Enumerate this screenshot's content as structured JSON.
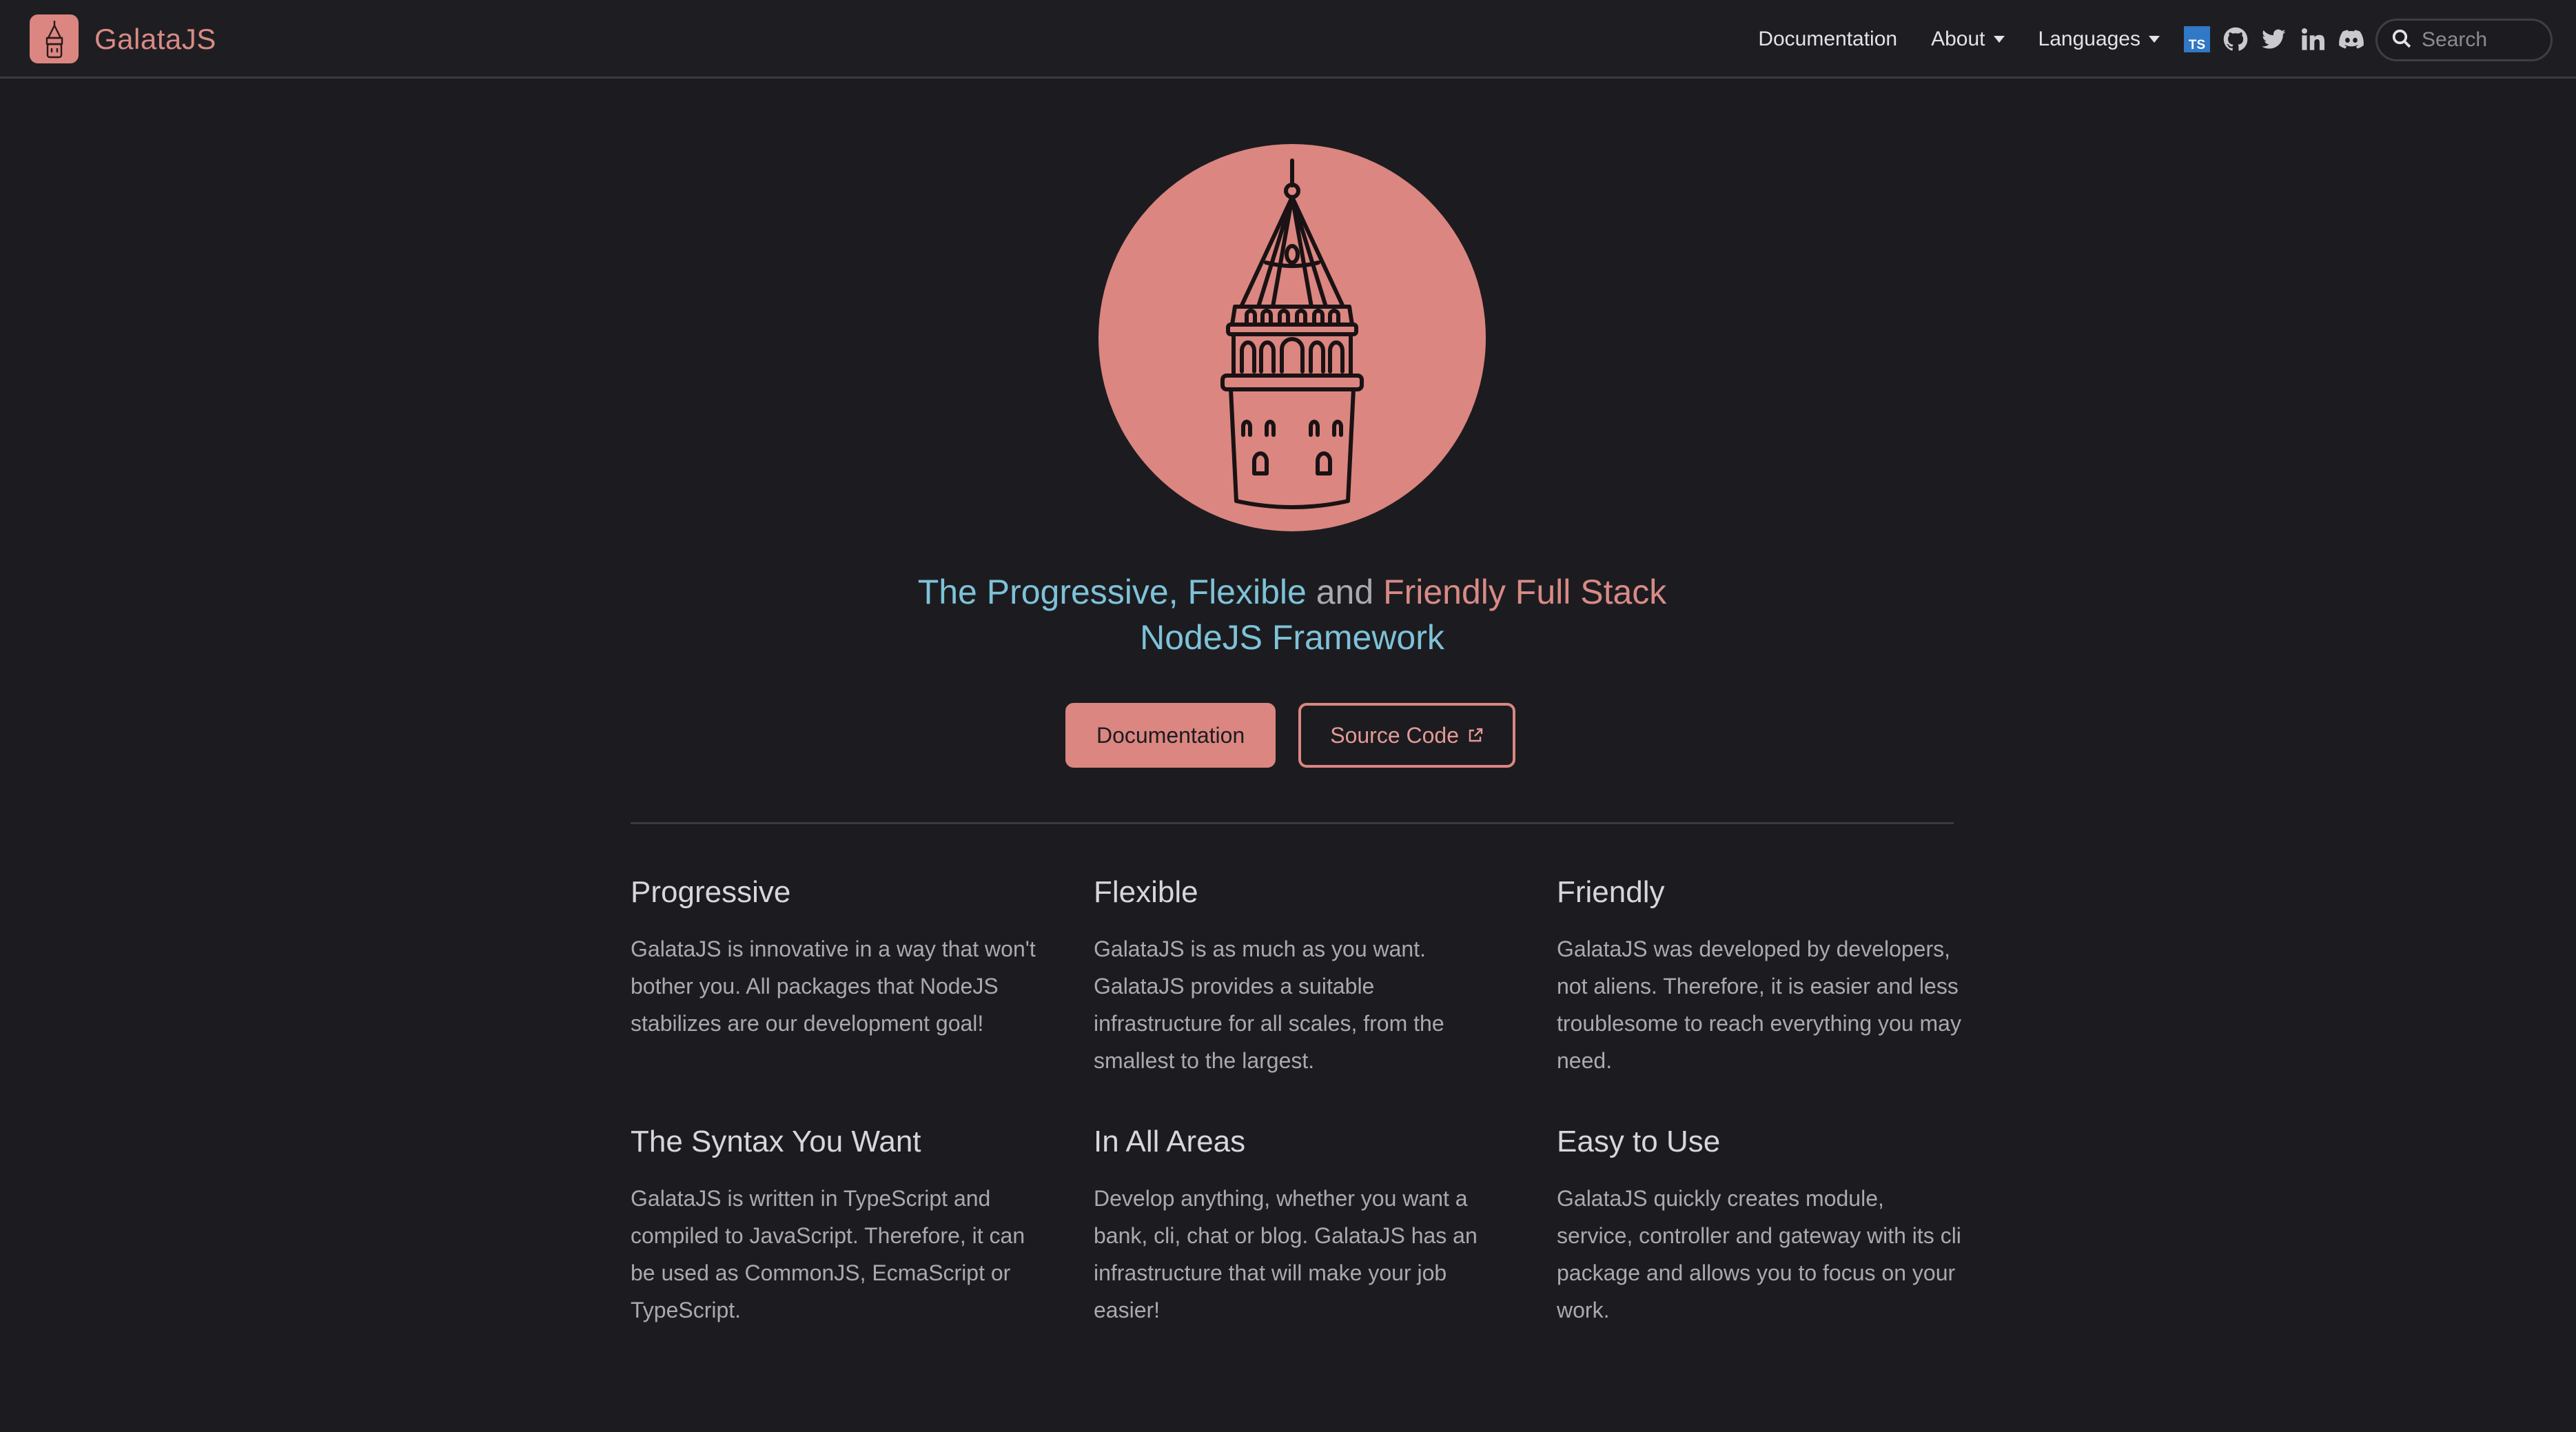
{
  "nav": {
    "brand": "GalataJS",
    "links": [
      {
        "label": "Documentation"
      },
      {
        "label": "About"
      },
      {
        "label": "Languages"
      }
    ],
    "icons": [
      "typescript-icon",
      "github-icon",
      "twitter-icon",
      "linkedin-icon",
      "discord-icon",
      "moon-icon"
    ],
    "search_placeholder": "Search"
  },
  "hero": {
    "tagline": {
      "progressive": "The Progressive,",
      "flexible": "Flexible",
      "and": "and",
      "friendly": "Friendly Full Stack",
      "line2": "NodeJS Framework"
    },
    "primary_button": "Documentation",
    "secondary_button": "Source Code"
  },
  "features": [
    {
      "title": "Progressive",
      "text": "GalataJS is innovative in a way that won't bother you. All packages that NodeJS stabilizes are our development goal!"
    },
    {
      "title": "Flexible",
      "text": "GalataJS is as much as you want. GalataJS provides a suitable infrastructure for all scales, from the smallest to the largest."
    },
    {
      "title": "Friendly",
      "text": "GalataJS was developed by developers, not aliens. Therefore, it is easier and less troublesome to reach everything you may need."
    },
    {
      "title": "The Syntax You Want",
      "text": "GalataJS is written in TypeScript and compiled to JavaScript. Therefore, it can be used as CommonJS, EcmaScript or TypeScript."
    },
    {
      "title": "In All Areas",
      "text": "Develop anything, whether you want a bank, cli, chat or blog. GalataJS has an infrastructure that will make your job easier!"
    },
    {
      "title": "Easy to Use",
      "text": "GalataJS quickly creates module, service, controller and gateway with its cli package and allows you to focus on your work."
    }
  ],
  "colors": {
    "background": "#1c1c20",
    "accent": "#db8680",
    "accent_blue": "#7ec2d8",
    "text": "#e3e3e6",
    "muted_text": "#a9a9b0"
  }
}
